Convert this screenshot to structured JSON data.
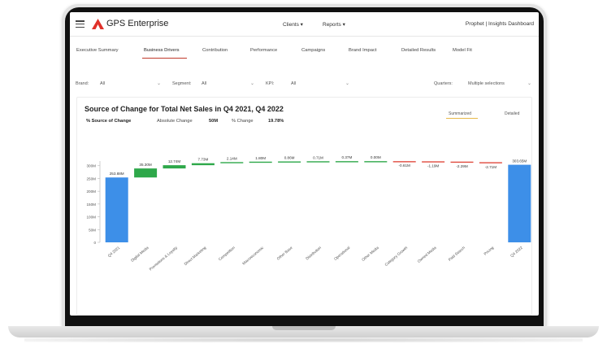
{
  "app": {
    "title": "GPS Enterprise",
    "menus": [
      "Clients ▾",
      "Reports ▾"
    ],
    "user_area": "Prophet  |  Insights Dashboard"
  },
  "tabs": [
    "Executive Summary",
    "Business Drivers",
    "Contribution",
    "Performance",
    "Campaigns",
    "Brand Impact",
    "Detailed Results",
    "Model Fit"
  ],
  "active_tab_index": 1,
  "filters": {
    "brand_label": "Brand:",
    "brand_value": "All",
    "segment_label": "Segment:",
    "segment_value": "All",
    "kpi_label": "KPI:",
    "kpi_value": "All",
    "quarters_label": "Quarters:",
    "quarters_value": "Multiple selections"
  },
  "card": {
    "title": "Source of Change for Total Net Sales in Q4 2021, Q4 2022",
    "pct_label": "% Source of Change",
    "abs_label": "Absolute Change",
    "abs_value": "50M",
    "pct_change_label": "% Change",
    "pct_change_value": "19.78%",
    "toggle_summarized": "Summarized",
    "toggle_detailed": "Detailed"
  },
  "colors": {
    "accent_red": "#c0392b",
    "bar_blue": "#3d8fe8",
    "bar_green": "#2ea84a",
    "bar_red": "#e04b3f",
    "toggle_underline": "#e8b949"
  },
  "chart_data": {
    "type": "bar",
    "subtype": "waterfall",
    "ylim": [
      0,
      350
    ],
    "y_ticks": [
      "0",
      "50M",
      "100M",
      "150M",
      "200M",
      "250M",
      "300M"
    ],
    "tick_values": [
      0,
      50,
      100,
      150,
      200,
      250,
      300
    ],
    "categories": [
      "Q4 2021",
      "Digital Media",
      "Promotions & Loyalty",
      "Direct Marketing",
      "Competition",
      "Macroeconomic",
      "Other Base",
      "Distribution",
      "Operational",
      "Other Media",
      "Category Growth",
      "Owned Media",
      "Paid Search",
      "Pricing",
      "Q4 2022"
    ],
    "values": [
      253.88,
      35.3,
      12.74,
      7.73,
      2.14,
      1.8,
      0.86,
      0.71,
      0.37,
      0.0,
      -0.61,
      -1.19,
      -2.29,
      -2.71,
      303.65
    ],
    "value_labels": [
      "253.88M",
      "35.30M",
      "12.74M",
      "7.73M",
      "2.14M",
      "1.80M",
      "0.86M",
      "0.71M",
      "0.37M",
      "0.00M",
      "-0.61M",
      "-1.19M",
      "-2.29M",
      "-2.71M",
      "303.65M"
    ],
    "kinds": [
      "total",
      "delta",
      "delta",
      "delta",
      "delta",
      "delta",
      "delta",
      "delta",
      "delta",
      "delta",
      "delta",
      "delta",
      "delta",
      "delta",
      "total"
    ],
    "grid": false,
    "legend": "none"
  }
}
